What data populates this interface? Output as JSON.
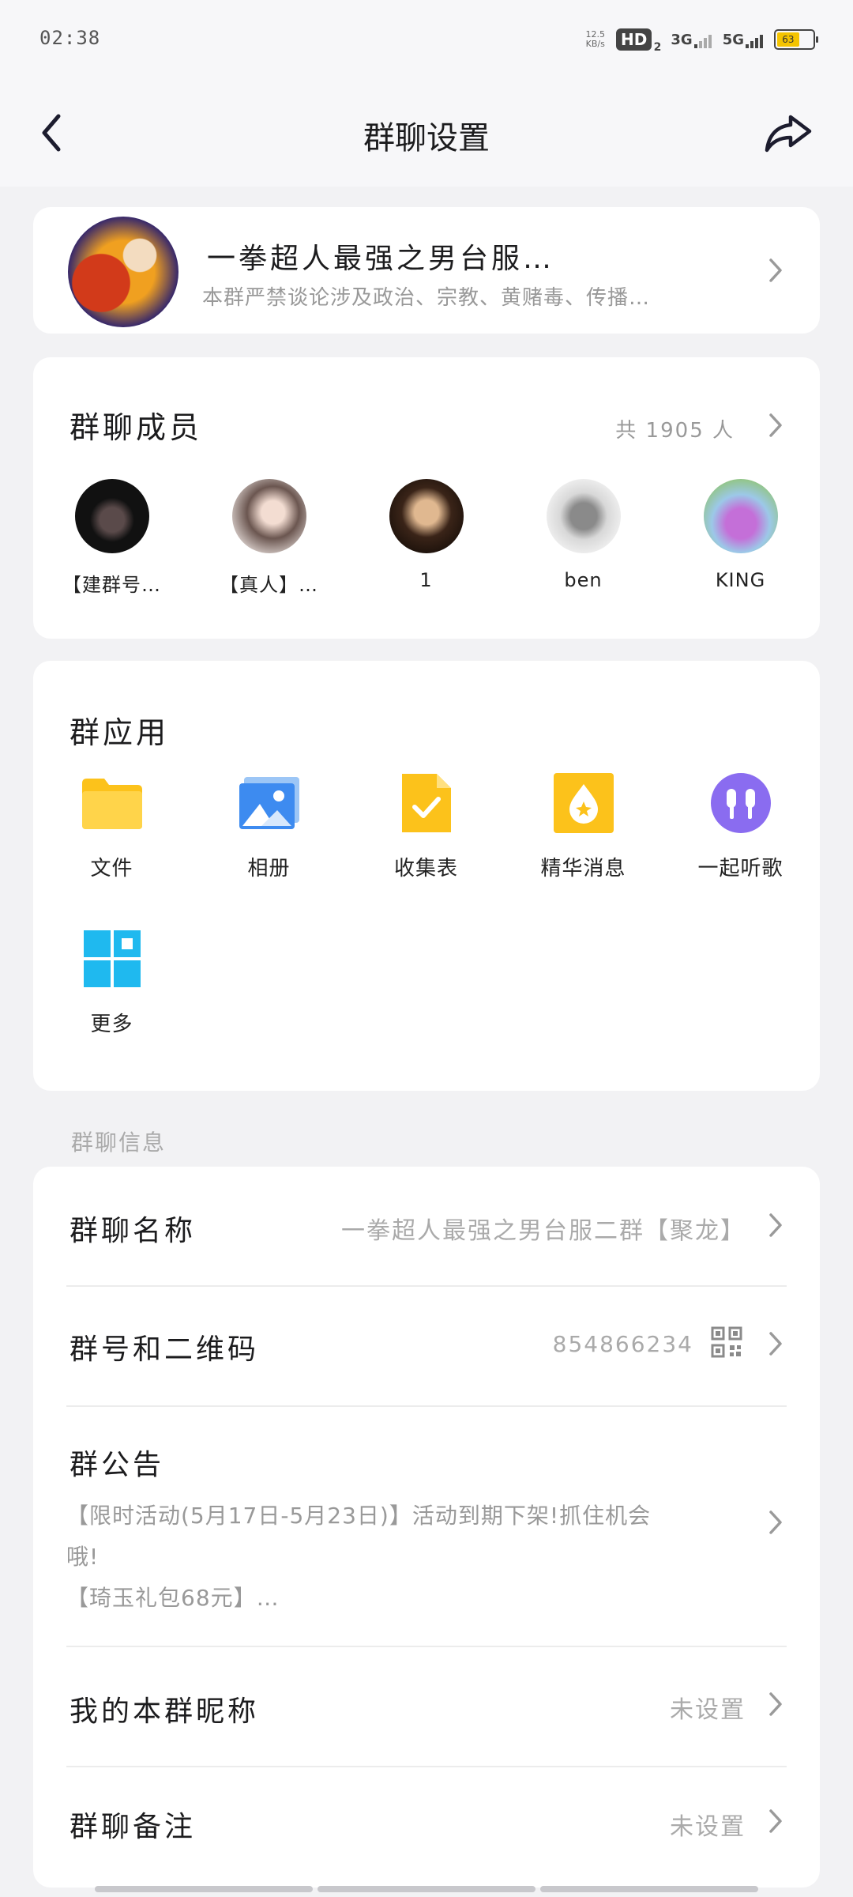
{
  "status_bar": {
    "time": "02:38",
    "net_speed_value": "12.5",
    "net_speed_unit": "KB/s",
    "hd_label": "HD",
    "hd_sub": "2",
    "net_3g": "3G",
    "net_5g": "5G",
    "battery_level": "63"
  },
  "header": {
    "title": "群聊设置",
    "back_icon": "chevron-left-icon",
    "share_icon": "share-arrow-icon"
  },
  "group": {
    "name": "一拳超人最强之男台服…",
    "description": "本群严禁谈论涉及政治、宗教、黄赌毒、传播…"
  },
  "members": {
    "title": "群聊成员",
    "count": "共 1905 人",
    "list": [
      {
        "name": "【建群号…"
      },
      {
        "name": "【真人】…"
      },
      {
        "name": "1"
      },
      {
        "name": "ben"
      },
      {
        "name": "KING"
      }
    ]
  },
  "apps": {
    "title": "群应用",
    "items": [
      {
        "label": "文件",
        "icon": "folder-icon"
      },
      {
        "label": "相册",
        "icon": "photo-album-icon"
      },
      {
        "label": "收集表",
        "icon": "form-check-icon"
      },
      {
        "label": "精华消息",
        "icon": "essence-drop-icon"
      },
      {
        "label": "一起听歌",
        "icon": "earphones-icon"
      },
      {
        "label": "更多",
        "icon": "grid-more-icon"
      }
    ]
  },
  "info": {
    "heading": "群聊信息",
    "group_name_label": "群聊名称",
    "group_name_value": "一拳超人最强之男台服二群【聚龙】",
    "group_number_label": "群号和二维码",
    "group_number_value": "854866234",
    "notice_label": "群公告",
    "notice_line1": "【限时活动(5月17日-5月23日)】活动到期下架!抓住机会",
    "notice_line2": "哦!",
    "notice_line3": "【琦玉礼包68元】…",
    "nickname_label": "我的本群昵称",
    "nickname_value": "未设置",
    "remark_label": "群聊备注",
    "remark_value": "未设置"
  },
  "colors": {
    "background": "#f2f2f4",
    "card": "#ffffff",
    "folder": "#fcc21b",
    "album": "#3d8bf0",
    "form": "#fcc21b",
    "essence": "#fcc21b",
    "music": "#8a6cf0",
    "more": "#1fb9ef"
  }
}
